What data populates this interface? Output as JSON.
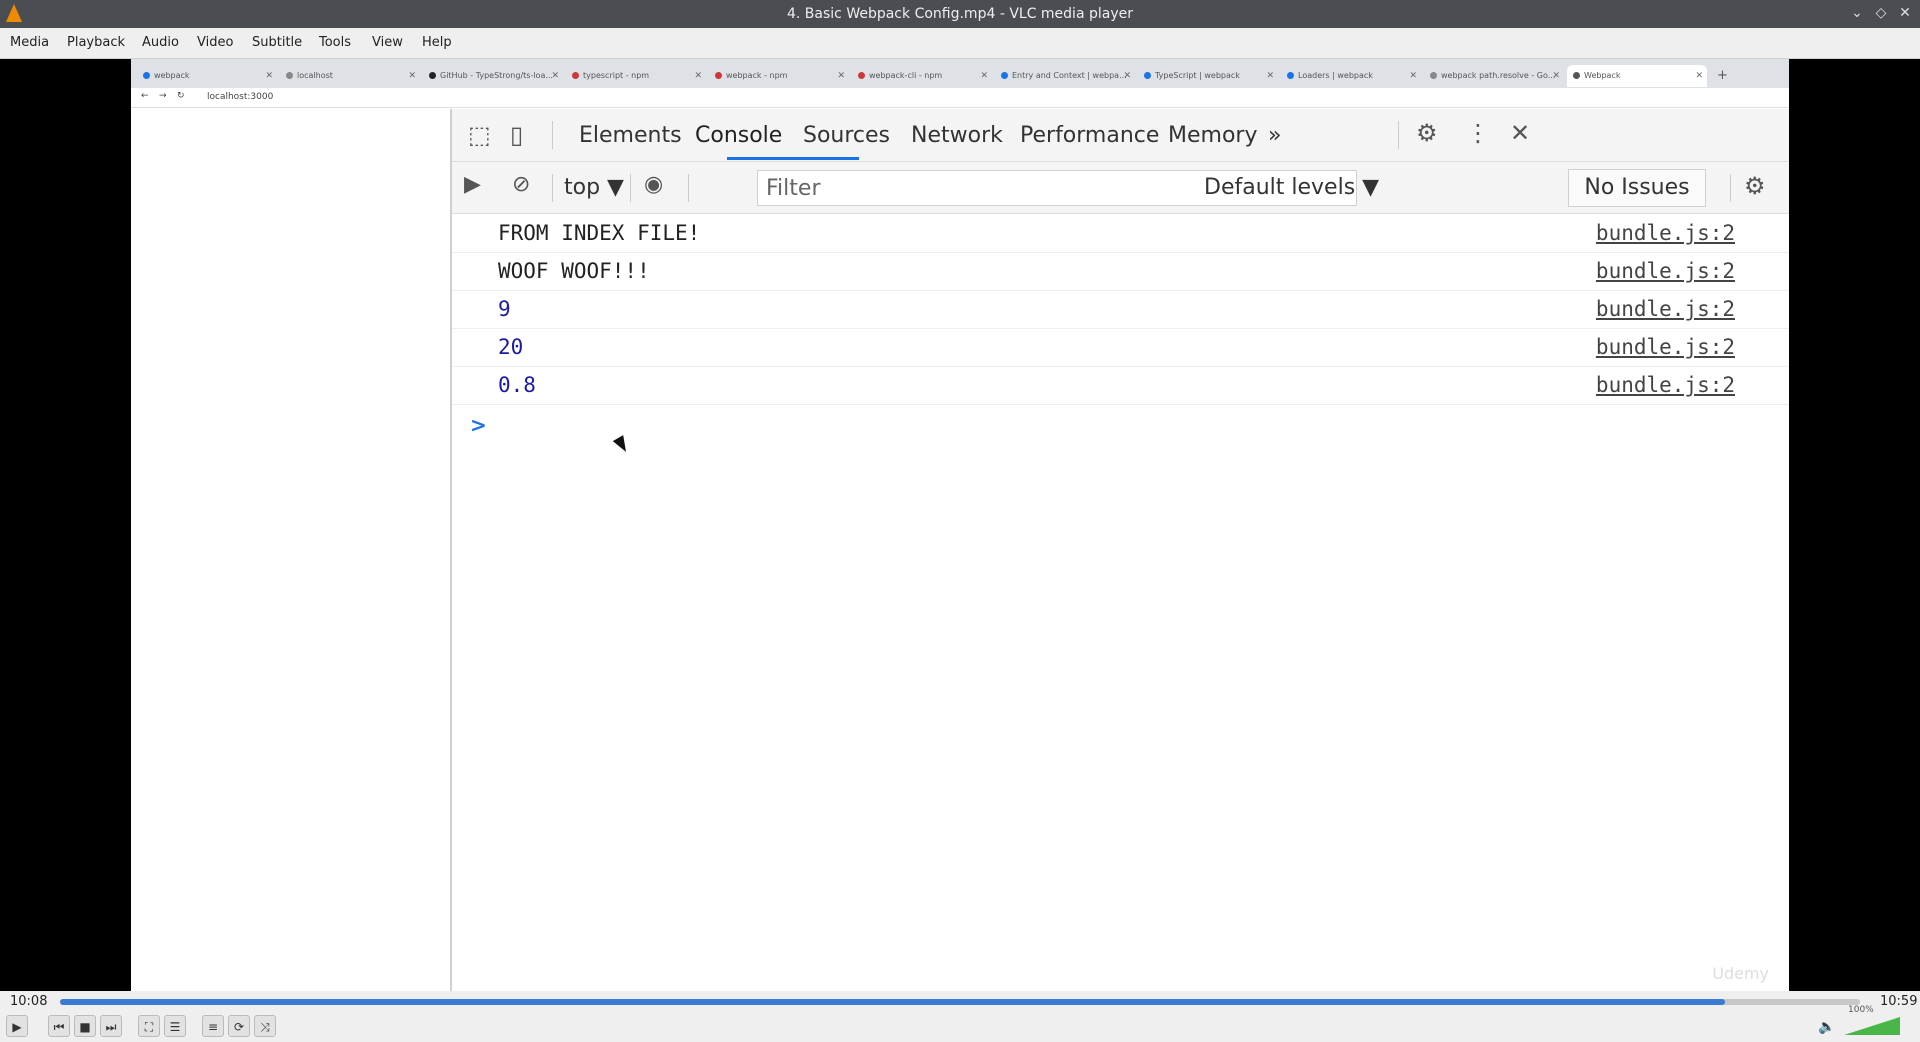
{
  "window": {
    "title": "4. Basic Webpack Config.mp4 - VLC media player"
  },
  "menu": [
    "Media",
    "Playback",
    "Audio",
    "Video",
    "Subtitle",
    "Tools",
    "View",
    "Help"
  ],
  "browser": {
    "tabs": [
      {
        "label": "webpack",
        "color": "#1a73e8"
      },
      {
        "label": "localhost",
        "color": "#888888"
      },
      {
        "label": "GitHub - TypeStrong/ts-loa...",
        "color": "#222222"
      },
      {
        "label": "typescript - npm",
        "color": "#cb3837"
      },
      {
        "label": "webpack - npm",
        "color": "#cb3837"
      },
      {
        "label": "webpack-cli - npm",
        "color": "#cb3837"
      },
      {
        "label": "Entry and Context | webpa...",
        "color": "#1a73e8"
      },
      {
        "label": "TypeScript | webpack",
        "color": "#1a73e8"
      },
      {
        "label": "Loaders | webpack",
        "color": "#1a73e8"
      },
      {
        "label": "webpack path.resolve - Go...",
        "color": "#888888"
      },
      {
        "label": "Webpack",
        "color": "#555555"
      }
    ],
    "address": "localhost:3000"
  },
  "devtools": {
    "tabs": [
      "Elements",
      "Console",
      "Sources",
      "Network",
      "Performance",
      "Memory"
    ],
    "context": "top ▼",
    "filter_placeholder": "Filter",
    "levels": "Default levels ▼",
    "issues": "No Issues",
    "console_rows": [
      {
        "msg": "FROM INDEX FILE!",
        "src": "bundle.js:2",
        "num": false
      },
      {
        "msg": "WOOF WOOF!!!",
        "src": "bundle.js:2",
        "num": false
      },
      {
        "msg": "9",
        "src": "bundle.js:2",
        "num": true
      },
      {
        "msg": "20",
        "src": "bundle.js:2",
        "num": true
      },
      {
        "msg": "0.8",
        "src": "bundle.js:2",
        "num": true
      }
    ],
    "prompt": ">"
  },
  "watermark": "Udemy",
  "player": {
    "elapsed": "10:08",
    "total": "10:59",
    "progress": 0.925,
    "volume": "100%"
  }
}
